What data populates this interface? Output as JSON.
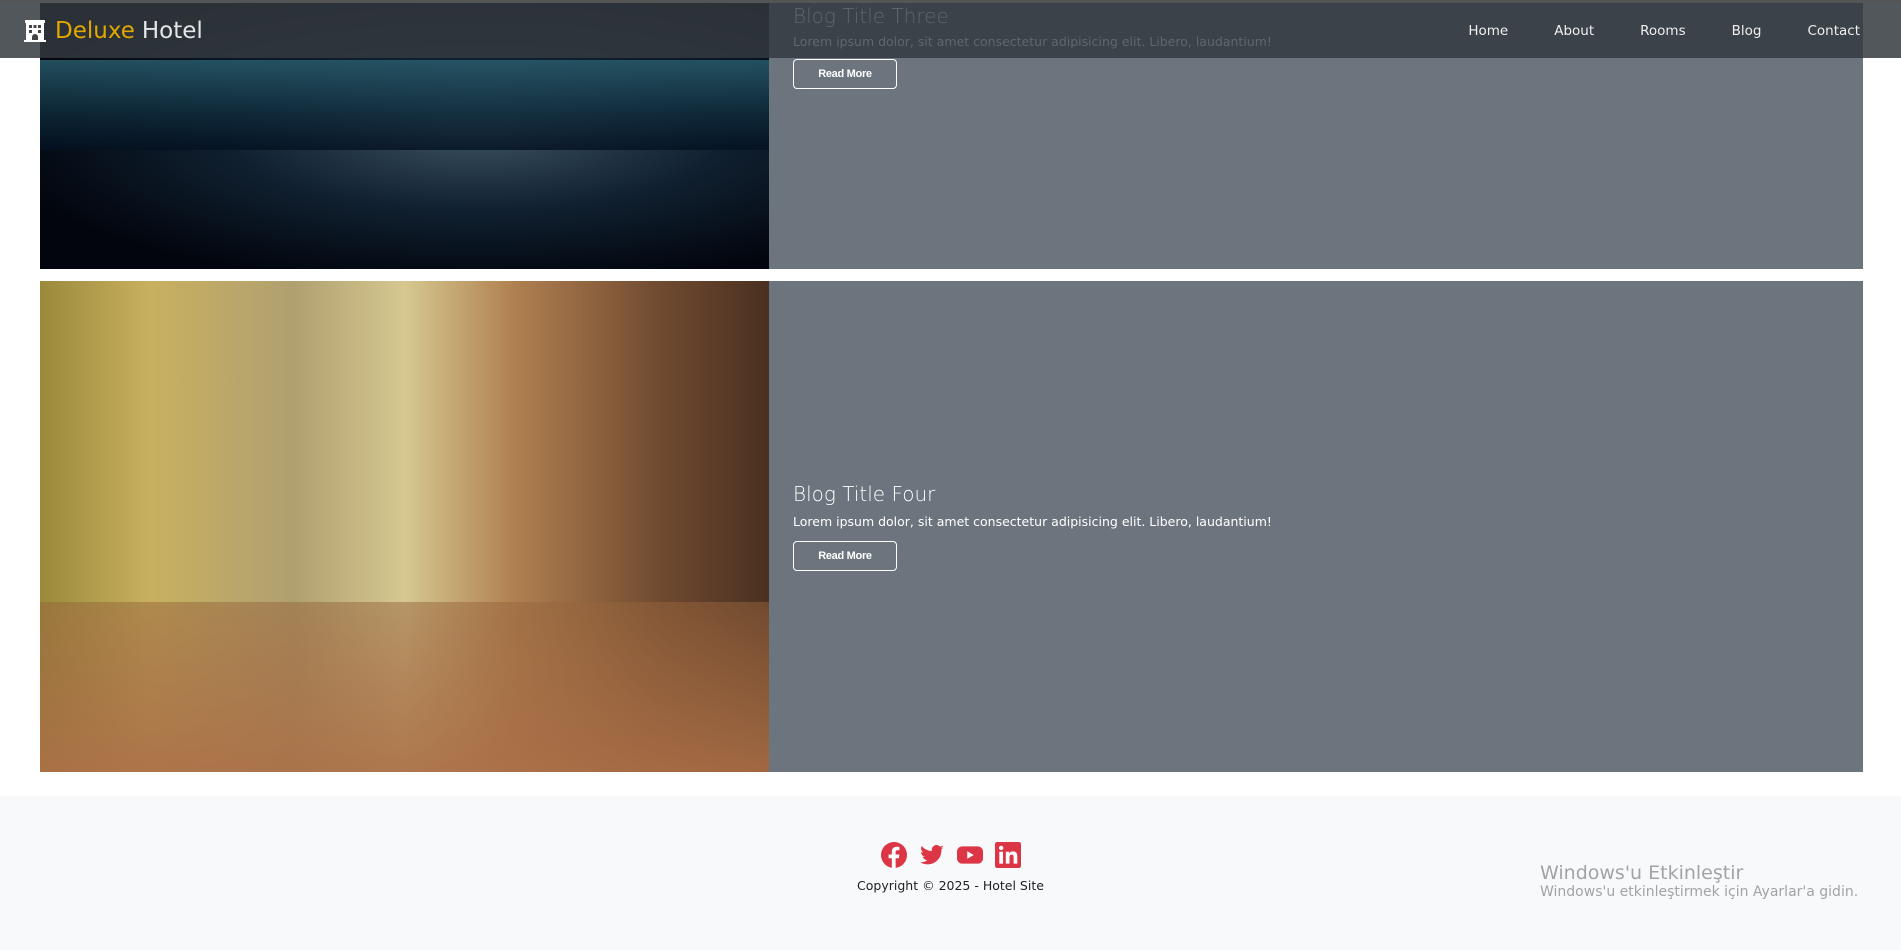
{
  "brand": {
    "first": "Deluxe",
    "second": "Hotel",
    "icon": "hotel-icon"
  },
  "nav": [
    {
      "label": "Home"
    },
    {
      "label": "About"
    },
    {
      "label": "Rooms"
    },
    {
      "label": "Blog"
    },
    {
      "label": "Contact"
    }
  ],
  "posts": [
    {
      "title": "Blog Title Three",
      "text": "Lorem ipsum dolor, sit amet consectetur adipisicing elit. Libero, laudantium!",
      "button": "Read More"
    },
    {
      "title": "Blog Title Four",
      "text": "Lorem ipsum dolor, sit amet consectetur adipisicing elit. Libero, laudantium!",
      "button": "Read More"
    }
  ],
  "footer": {
    "social": [
      "facebook-icon",
      "twitter-icon",
      "youtube-icon",
      "linkedin-icon"
    ],
    "social_color": "#dc3545",
    "copyright": "Copyright © 2025 - Hotel Site"
  },
  "watermark": {
    "title": "Windows'u Etkinleştir",
    "subtitle": "Windows'u etkinleştirmek için Ayarlar'a gidin."
  }
}
